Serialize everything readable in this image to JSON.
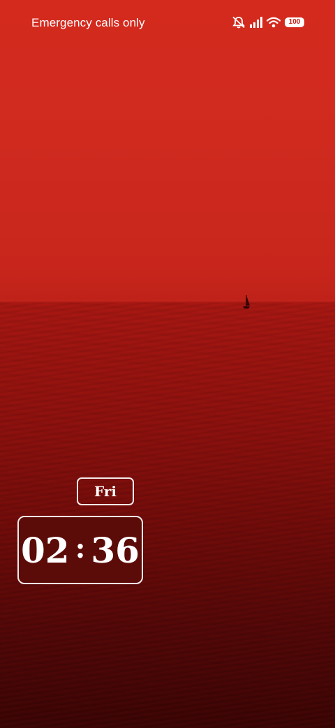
{
  "status_bar": {
    "carrier_text": "Emergency calls only",
    "battery_level": "100",
    "icons": [
      "bell-muted-icon",
      "signal-icon",
      "wifi-icon",
      "battery-icon"
    ]
  },
  "clock_widget": {
    "day": "Fri",
    "hours": "02",
    "separator": ":",
    "minutes": "36"
  },
  "wallpaper": {
    "colors": {
      "sky": "#d42a1e",
      "sea_top": "#9c1410",
      "sea_bottom": "#3a0404",
      "widget_fill": "#5c0c08",
      "widget_border": "#f4eaea"
    }
  }
}
